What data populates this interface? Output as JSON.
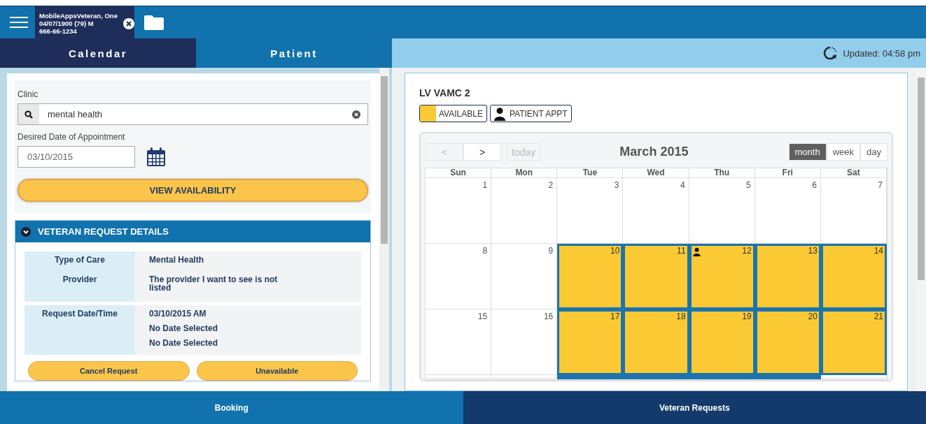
{
  "header": {
    "patient": {
      "name": "MobileAppsVeteran, One",
      "dob": "04/07/1900 (79) M",
      "ssn": "666-66-1234"
    }
  },
  "tabs": [
    {
      "label": "Calendar",
      "selected": true
    },
    {
      "label": "Patient",
      "selected": false
    }
  ],
  "status": {
    "updated": "Updated: 04:58 pm"
  },
  "form": {
    "clinic_label": "Clinic",
    "clinic_value": "mental health",
    "date_label": "Desired Date of Appointment",
    "date_value": "03/10/2015",
    "view_button": "VIEW AVAILABILITY"
  },
  "request_details": {
    "title": "VETERAN REQUEST DETAILS",
    "expanded": true,
    "groups": [
      {
        "rows": [
          {
            "label": "Type of Care",
            "values": [
              "Mental Health"
            ]
          },
          {
            "label": "Provider",
            "values": [
              "The provider I want to see is not listed"
            ]
          }
        ]
      },
      {
        "rows": [
          {
            "label": "Request Date/Time",
            "values": [
              "03/10/2015 AM",
              "No Date Selected",
              "No Date Selected"
            ]
          }
        ]
      }
    ],
    "buttons": [
      "Cancel Request",
      "Unavailable"
    ]
  },
  "calendar": {
    "clinic": "LV VAMC 2",
    "legend": [
      {
        "kind": "swatch",
        "label": "AVAILABLE"
      },
      {
        "kind": "person",
        "label": "PATIENT APPT"
      }
    ],
    "nav": [
      {
        "label": "<",
        "disabled": true
      },
      {
        "label": ">",
        "disabled": false
      },
      {
        "label": "today",
        "disabled": true
      }
    ],
    "title": "March 2015",
    "views": [
      {
        "label": "month",
        "selected": true
      },
      {
        "label": "week",
        "selected": false
      },
      {
        "label": "day",
        "selected": false
      }
    ],
    "weekdays": [
      "Sun",
      "Mon",
      "Tue",
      "Wed",
      "Thu",
      "Fri",
      "Sat"
    ],
    "weeks": [
      [
        {
          "day": "1",
          "available": false,
          "patient_appt": false
        },
        {
          "day": "2",
          "available": false,
          "patient_appt": false
        },
        {
          "day": "3",
          "available": false,
          "patient_appt": false
        },
        {
          "day": "4",
          "available": false,
          "patient_appt": false
        },
        {
          "day": "5",
          "available": false,
          "patient_appt": false
        },
        {
          "day": "6",
          "available": false,
          "patient_appt": false
        },
        {
          "day": "7",
          "available": false,
          "patient_appt": false
        }
      ],
      [
        {
          "day": "8",
          "available": false,
          "patient_appt": false
        },
        {
          "day": "9",
          "available": false,
          "patient_appt": false
        },
        {
          "day": "10",
          "available": true,
          "patient_appt": false
        },
        {
          "day": "11",
          "available": true,
          "patient_appt": false
        },
        {
          "day": "12",
          "available": true,
          "patient_appt": true
        },
        {
          "day": "13",
          "available": true,
          "patient_appt": false
        },
        {
          "day": "14",
          "available": true,
          "patient_appt": false
        }
      ],
      [
        {
          "day": "15",
          "available": false,
          "patient_appt": false
        },
        {
          "day": "16",
          "available": false,
          "patient_appt": false
        },
        {
          "day": "17",
          "available": true,
          "patient_appt": false
        },
        {
          "day": "18",
          "available": true,
          "patient_appt": false
        },
        {
          "day": "19",
          "available": true,
          "patient_appt": false
        },
        {
          "day": "20",
          "available": true,
          "patient_appt": false
        },
        {
          "day": "21",
          "available": true,
          "patient_appt": false
        }
      ],
      [
        {
          "available": false,
          "patient_appt": false
        },
        {
          "available": false,
          "patient_appt": false
        },
        {
          "available": true,
          "patient_appt": false
        },
        {
          "available": true,
          "patient_appt": false
        },
        {
          "available": true,
          "patient_appt": false
        },
        {
          "available": true,
          "patient_appt": false
        },
        {
          "available": false,
          "patient_appt": false
        }
      ]
    ]
  },
  "bottom_nav": [
    {
      "label": "Booking",
      "selected": false
    },
    {
      "label": "Veteran Requests",
      "selected": true
    }
  ]
}
